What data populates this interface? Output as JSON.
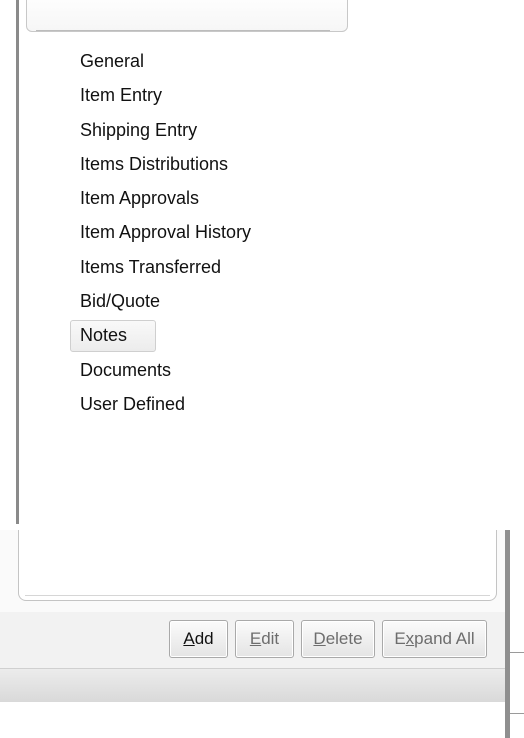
{
  "navigation": {
    "items": [
      {
        "label": "General"
      },
      {
        "label": "Item Entry"
      },
      {
        "label": "Shipping Entry"
      },
      {
        "label": "Items Distributions"
      },
      {
        "label": "Item Approvals"
      },
      {
        "label": "Item Approval History"
      },
      {
        "label": "Items Transferred"
      },
      {
        "label": "Bid/Quote"
      },
      {
        "label": "Notes"
      },
      {
        "label": "Documents"
      },
      {
        "label": "User Defined"
      }
    ],
    "selected": "Notes"
  },
  "toolbar": {
    "add": {
      "pre": "",
      "key": "A",
      "post": "dd"
    },
    "edit": {
      "pre": "",
      "key": "E",
      "post": "dit"
    },
    "delete": {
      "pre": "",
      "key": "D",
      "post": "elete"
    },
    "expand_all": {
      "pre": "E",
      "key": "x",
      "post": "pand All"
    }
  }
}
